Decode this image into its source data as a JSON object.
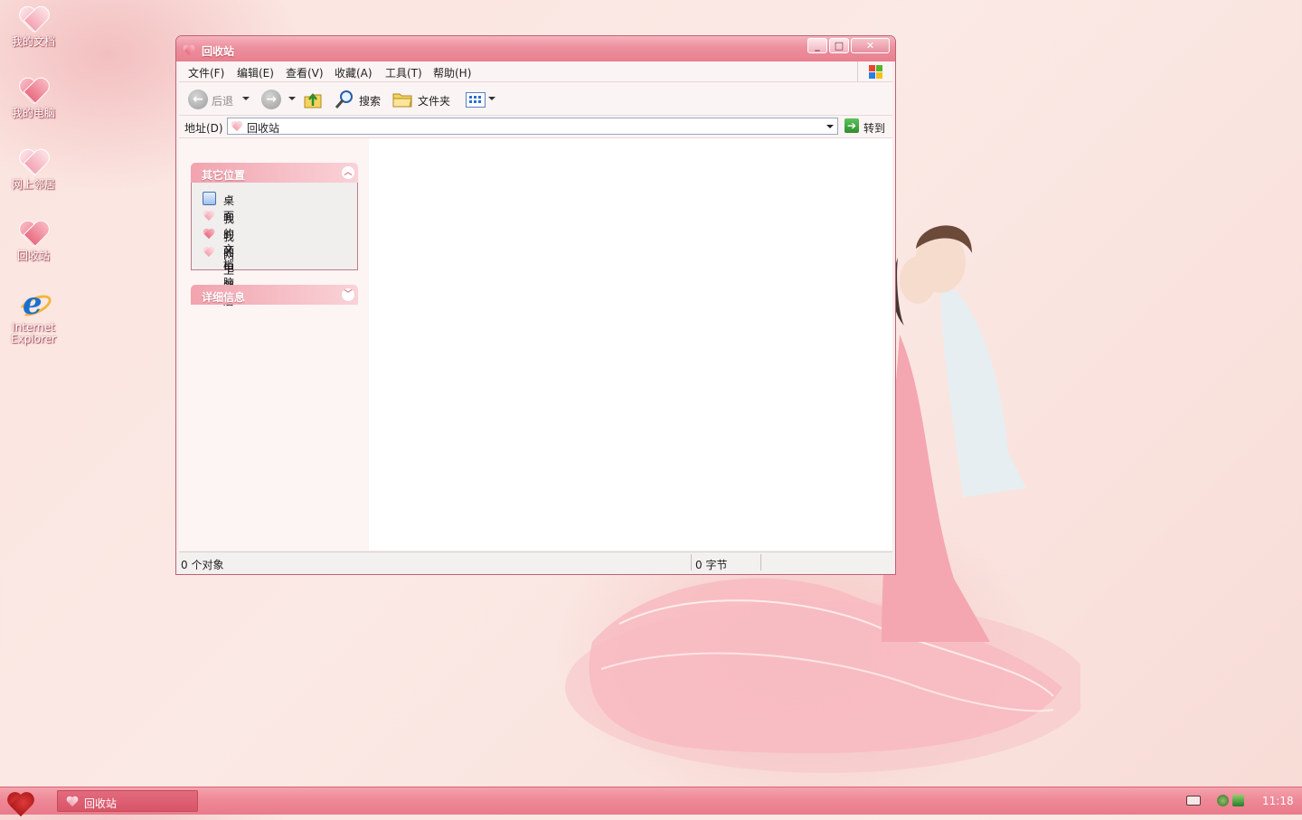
{
  "desktop": {
    "icons": [
      {
        "label": "我的文档"
      },
      {
        "label": "我的电脑"
      },
      {
        "label": "网上邻居"
      },
      {
        "label": "回收站"
      },
      {
        "label": "Internet Explorer"
      }
    ]
  },
  "window": {
    "title": "回收站",
    "menu": [
      "文件(F)",
      "编辑(E)",
      "查看(V)",
      "收藏(A)",
      "工具(T)",
      "帮助(H)"
    ],
    "toolbar": {
      "back_label": "后退",
      "search_label": "搜索",
      "folders_label": "文件夹"
    },
    "address": {
      "label": "地址(D)",
      "value": "回收站",
      "go_label": "转到"
    },
    "taskpane": {
      "other_places": {
        "title": "其它位置",
        "items": [
          {
            "label": "桌面",
            "icon": "desktop-icon"
          },
          {
            "label": "我的文档",
            "icon": "heart-icon"
          },
          {
            "label": "我的电脑",
            "icon": "heart-icon"
          },
          {
            "label": "网上邻居",
            "icon": "heart-icon"
          }
        ]
      },
      "details": {
        "title": "详细信息"
      }
    },
    "status": {
      "objects": "0 个对象",
      "size": "0 字节"
    }
  },
  "taskbar": {
    "task": "回收站",
    "clock": "11:18"
  },
  "colors": {
    "accent": "#ec8f9d",
    "taskbar": "#ee8796"
  }
}
